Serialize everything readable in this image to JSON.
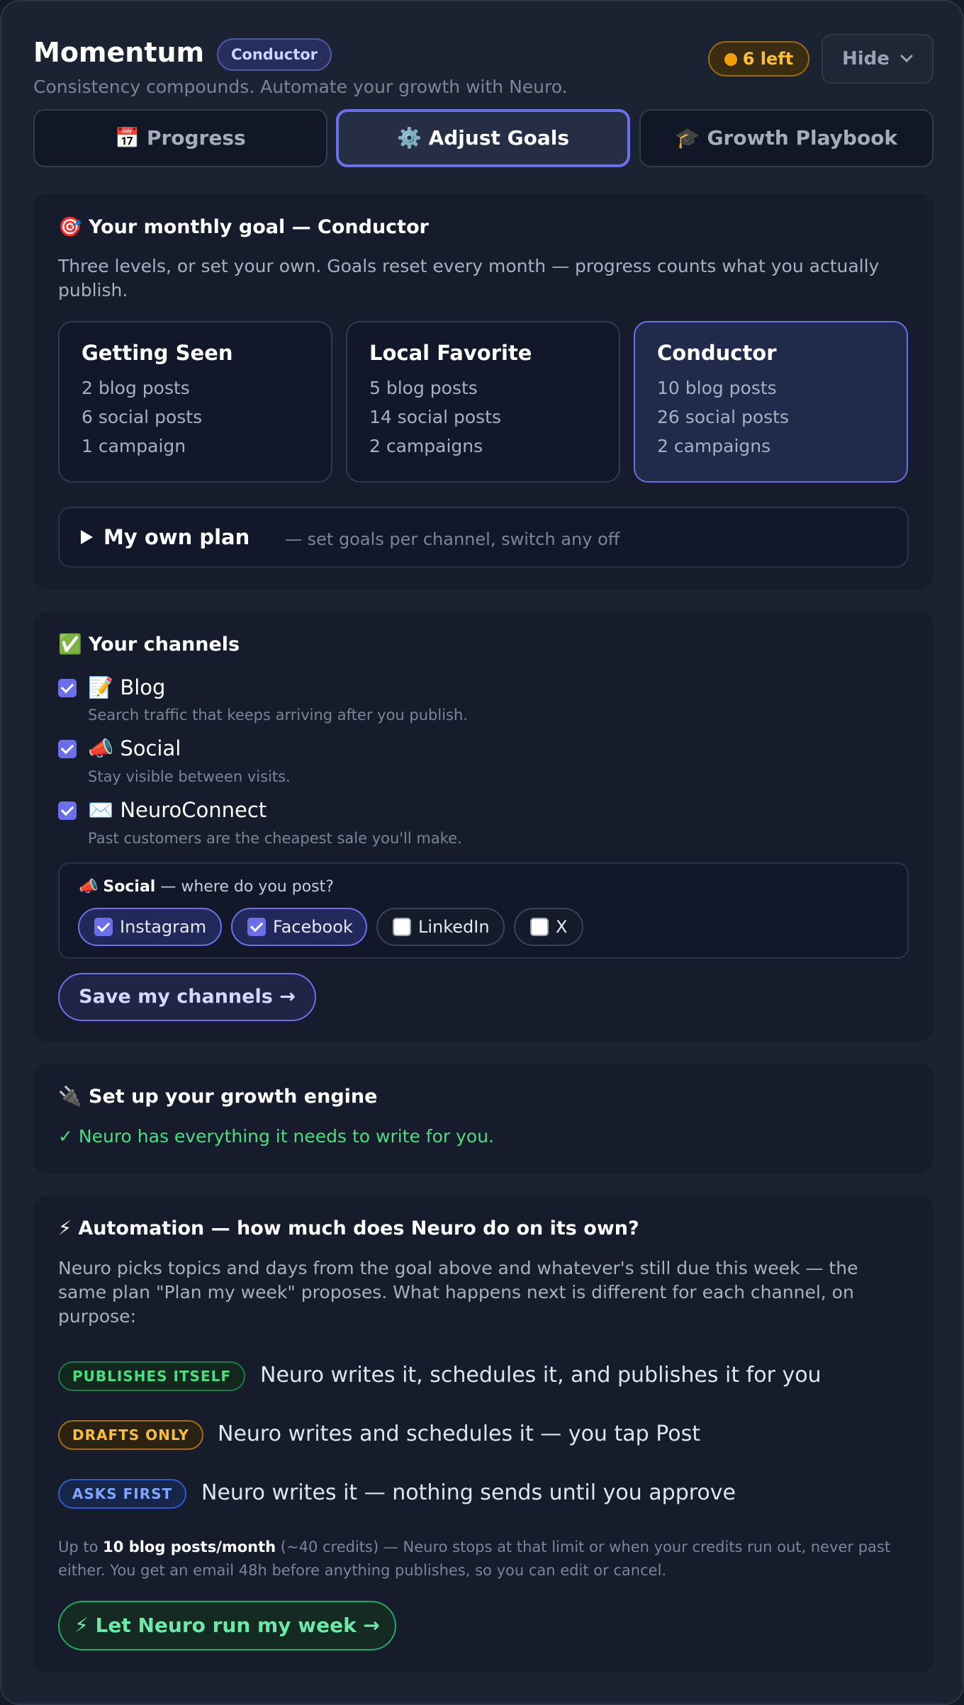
{
  "header": {
    "title": "Momentum",
    "tier_badge": "Conductor",
    "subtitle": "Consistency compounds. Automate your growth with Neuro.",
    "credits": "6 left",
    "hide_label": "Hide"
  },
  "tabs": [
    {
      "icon": "📅",
      "label": "Progress"
    },
    {
      "icon": "⚙️",
      "label": "Adjust Goals"
    },
    {
      "icon": "🎓",
      "label": "Growth Playbook"
    }
  ],
  "goal_card": {
    "icon": "🎯",
    "title": "Your monthly goal — Conductor",
    "description": "Three levels, or set your own. Goals reset every month — progress counts what you actually publish.",
    "levels": [
      {
        "name": "Getting Seen",
        "lines": [
          "2 blog posts",
          "6 social posts",
          "1 campaign"
        ]
      },
      {
        "name": "Local Favorite",
        "lines": [
          "5 blog posts",
          "14 social posts",
          "2 campaigns"
        ]
      },
      {
        "name": "Conductor",
        "lines": [
          "10 blog posts",
          "26 social posts",
          "2 campaigns"
        ]
      }
    ],
    "own_plan_label": "My own plan",
    "own_plan_hint": "— set goals per channel, switch any off"
  },
  "channels_card": {
    "icon": "✅",
    "title": "Your channels",
    "channels": [
      {
        "icon": "📝",
        "name": "Blog",
        "desc": "Search traffic that keeps arriving after you publish."
      },
      {
        "icon": "📣",
        "name": "Social",
        "desc": "Stay visible between visits."
      },
      {
        "icon": "✉️",
        "name": "NeuroConnect",
        "desc": "Past customers are the cheapest sale you'll make."
      }
    ],
    "social_icon": "📣",
    "social_label": "Social",
    "social_question": "— where do you post?",
    "platforms": [
      "Instagram",
      "Facebook",
      "LinkedIn",
      "X"
    ],
    "save_label": "Save my channels →"
  },
  "engine_card": {
    "icon": "🔌",
    "title": "Set up your growth engine",
    "status": "✓ Neuro has everything it needs to write for you."
  },
  "automation_card": {
    "icon": "⚡",
    "title": "Automation — how much does Neuro do on its own?",
    "description": "Neuro picks topics and days from the goal above and whatever's still due this week — the same plan \"Plan my week\" proposes. What happens next is different for each channel, on purpose:",
    "modes": [
      {
        "badge": "PUBLISHES ITSELF",
        "text": "Neuro writes it, schedules it, and publishes it for you"
      },
      {
        "badge": "DRAFTS ONLY",
        "text": "Neuro writes and schedules it — you tap Post"
      },
      {
        "badge": "ASKS FIRST",
        "text": "Neuro writes it — nothing sends until you approve"
      }
    ],
    "fine_prefix": "Up to",
    "fine_bold": "10 blog posts/month",
    "fine_rest": "(~40 credits) — Neuro stops at that limit or when your credits run out, never past either. You get an email 48h before anything publishes, so you can edit or cancel.",
    "run_label": "⚡ Let Neuro run my week →"
  }
}
